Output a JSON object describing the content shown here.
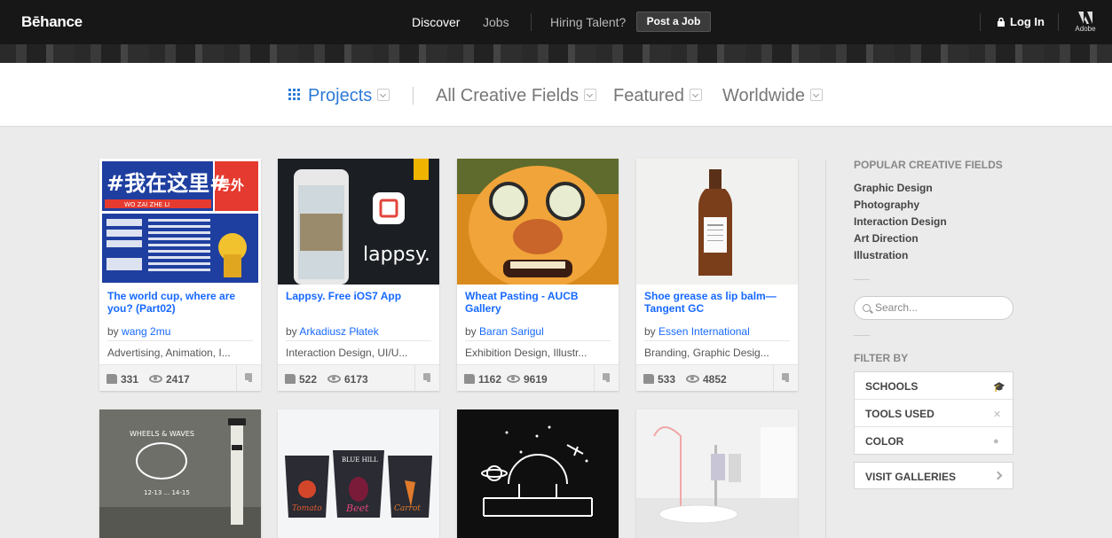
{
  "header": {
    "logo": "Bēhance",
    "nav": [
      "Discover",
      "Jobs",
      "Hiring Talent?"
    ],
    "post_job": "Post a Job",
    "login": "Log In",
    "adobe": "Adobe"
  },
  "filters": {
    "projects": "Projects",
    "fields": "All Creative Fields",
    "featured": "Featured",
    "worldwide": "Worldwide"
  },
  "projects": [
    {
      "title": "The world cup, where are you? (Part02)",
      "by": "by",
      "owner": "wang 2mu",
      "fields": "Advertising, Animation, I...",
      "likes": "331",
      "views": "2417"
    },
    {
      "title": "Lappsy. Free iOS7 App",
      "by": "by",
      "owner": "Arkadiusz Płatek",
      "fields": "Interaction Design, UI/U...",
      "likes": "522",
      "views": "6173"
    },
    {
      "title": "Wheat Pasting - AUCB Gallery",
      "by": "by",
      "owner": "Baran Sarigul",
      "fields": "Exhibition Design, Illustr...",
      "likes": "1162",
      "views": "9619"
    },
    {
      "title": "Shoe grease as lip balm—Tangent GC",
      "by": "by",
      "owner": "Essen International",
      "fields": "Branding, Graphic Desig...",
      "likes": "533",
      "views": "4852"
    }
  ],
  "thumb_text": {
    "wc_title": "#我在这里#",
    "wc_sub": "号外",
    "wc_pinyin": "WO ZAI ZHE LI",
    "lappsy": "lappsy.",
    "wheels": "WHEELS & WAVES",
    "wheels_dates": "12-13 ... 14-15",
    "beet": "Beet",
    "tomato": "Tomato",
    "carrot": "Carrot",
    "blue_hill": "BLUE HILL"
  },
  "sidebar": {
    "popular_heading": "POPULAR CREATIVE FIELDS",
    "popular": [
      "Graphic Design",
      "Photography",
      "Interaction Design",
      "Art Direction",
      "Illustration"
    ],
    "search_placeholder": "Search...",
    "filter_heading": "FILTER BY",
    "filters": [
      "SCHOOLS",
      "TOOLS USED",
      "COLOR"
    ],
    "galleries": "VISIT GALLERIES"
  },
  "colors": {
    "accent": "#2d7ad7",
    "link": "#1769ff",
    "nav_bg": "#171717"
  }
}
